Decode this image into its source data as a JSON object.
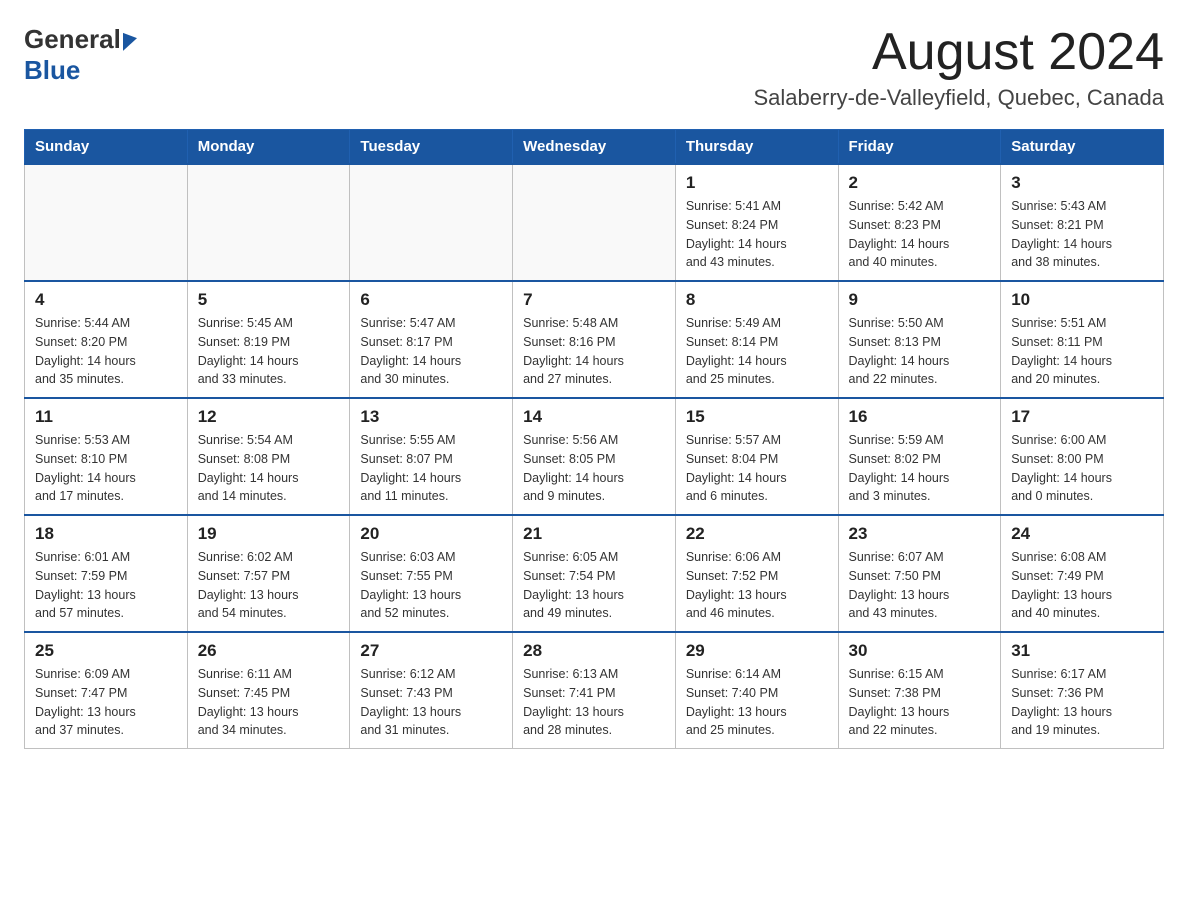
{
  "header": {
    "logo_general": "General",
    "logo_blue": "Blue",
    "month_title": "August 2024",
    "location": "Salaberry-de-Valleyfield, Quebec, Canada"
  },
  "days_of_week": [
    "Sunday",
    "Monday",
    "Tuesday",
    "Wednesday",
    "Thursday",
    "Friday",
    "Saturday"
  ],
  "weeks": [
    {
      "days": [
        {
          "number": "",
          "info": ""
        },
        {
          "number": "",
          "info": ""
        },
        {
          "number": "",
          "info": ""
        },
        {
          "number": "",
          "info": ""
        },
        {
          "number": "1",
          "info": "Sunrise: 5:41 AM\nSunset: 8:24 PM\nDaylight: 14 hours\nand 43 minutes."
        },
        {
          "number": "2",
          "info": "Sunrise: 5:42 AM\nSunset: 8:23 PM\nDaylight: 14 hours\nand 40 minutes."
        },
        {
          "number": "3",
          "info": "Sunrise: 5:43 AM\nSunset: 8:21 PM\nDaylight: 14 hours\nand 38 minutes."
        }
      ]
    },
    {
      "days": [
        {
          "number": "4",
          "info": "Sunrise: 5:44 AM\nSunset: 8:20 PM\nDaylight: 14 hours\nand 35 minutes."
        },
        {
          "number": "5",
          "info": "Sunrise: 5:45 AM\nSunset: 8:19 PM\nDaylight: 14 hours\nand 33 minutes."
        },
        {
          "number": "6",
          "info": "Sunrise: 5:47 AM\nSunset: 8:17 PM\nDaylight: 14 hours\nand 30 minutes."
        },
        {
          "number": "7",
          "info": "Sunrise: 5:48 AM\nSunset: 8:16 PM\nDaylight: 14 hours\nand 27 minutes."
        },
        {
          "number": "8",
          "info": "Sunrise: 5:49 AM\nSunset: 8:14 PM\nDaylight: 14 hours\nand 25 minutes."
        },
        {
          "number": "9",
          "info": "Sunrise: 5:50 AM\nSunset: 8:13 PM\nDaylight: 14 hours\nand 22 minutes."
        },
        {
          "number": "10",
          "info": "Sunrise: 5:51 AM\nSunset: 8:11 PM\nDaylight: 14 hours\nand 20 minutes."
        }
      ]
    },
    {
      "days": [
        {
          "number": "11",
          "info": "Sunrise: 5:53 AM\nSunset: 8:10 PM\nDaylight: 14 hours\nand 17 minutes."
        },
        {
          "number": "12",
          "info": "Sunrise: 5:54 AM\nSunset: 8:08 PM\nDaylight: 14 hours\nand 14 minutes."
        },
        {
          "number": "13",
          "info": "Sunrise: 5:55 AM\nSunset: 8:07 PM\nDaylight: 14 hours\nand 11 minutes."
        },
        {
          "number": "14",
          "info": "Sunrise: 5:56 AM\nSunset: 8:05 PM\nDaylight: 14 hours\nand 9 minutes."
        },
        {
          "number": "15",
          "info": "Sunrise: 5:57 AM\nSunset: 8:04 PM\nDaylight: 14 hours\nand 6 minutes."
        },
        {
          "number": "16",
          "info": "Sunrise: 5:59 AM\nSunset: 8:02 PM\nDaylight: 14 hours\nand 3 minutes."
        },
        {
          "number": "17",
          "info": "Sunrise: 6:00 AM\nSunset: 8:00 PM\nDaylight: 14 hours\nand 0 minutes."
        }
      ]
    },
    {
      "days": [
        {
          "number": "18",
          "info": "Sunrise: 6:01 AM\nSunset: 7:59 PM\nDaylight: 13 hours\nand 57 minutes."
        },
        {
          "number": "19",
          "info": "Sunrise: 6:02 AM\nSunset: 7:57 PM\nDaylight: 13 hours\nand 54 minutes."
        },
        {
          "number": "20",
          "info": "Sunrise: 6:03 AM\nSunset: 7:55 PM\nDaylight: 13 hours\nand 52 minutes."
        },
        {
          "number": "21",
          "info": "Sunrise: 6:05 AM\nSunset: 7:54 PM\nDaylight: 13 hours\nand 49 minutes."
        },
        {
          "number": "22",
          "info": "Sunrise: 6:06 AM\nSunset: 7:52 PM\nDaylight: 13 hours\nand 46 minutes."
        },
        {
          "number": "23",
          "info": "Sunrise: 6:07 AM\nSunset: 7:50 PM\nDaylight: 13 hours\nand 43 minutes."
        },
        {
          "number": "24",
          "info": "Sunrise: 6:08 AM\nSunset: 7:49 PM\nDaylight: 13 hours\nand 40 minutes."
        }
      ]
    },
    {
      "days": [
        {
          "number": "25",
          "info": "Sunrise: 6:09 AM\nSunset: 7:47 PM\nDaylight: 13 hours\nand 37 minutes."
        },
        {
          "number": "26",
          "info": "Sunrise: 6:11 AM\nSunset: 7:45 PM\nDaylight: 13 hours\nand 34 minutes."
        },
        {
          "number": "27",
          "info": "Sunrise: 6:12 AM\nSunset: 7:43 PM\nDaylight: 13 hours\nand 31 minutes."
        },
        {
          "number": "28",
          "info": "Sunrise: 6:13 AM\nSunset: 7:41 PM\nDaylight: 13 hours\nand 28 minutes."
        },
        {
          "number": "29",
          "info": "Sunrise: 6:14 AM\nSunset: 7:40 PM\nDaylight: 13 hours\nand 25 minutes."
        },
        {
          "number": "30",
          "info": "Sunrise: 6:15 AM\nSunset: 7:38 PM\nDaylight: 13 hours\nand 22 minutes."
        },
        {
          "number": "31",
          "info": "Sunrise: 6:17 AM\nSunset: 7:36 PM\nDaylight: 13 hours\nand 19 minutes."
        }
      ]
    }
  ]
}
